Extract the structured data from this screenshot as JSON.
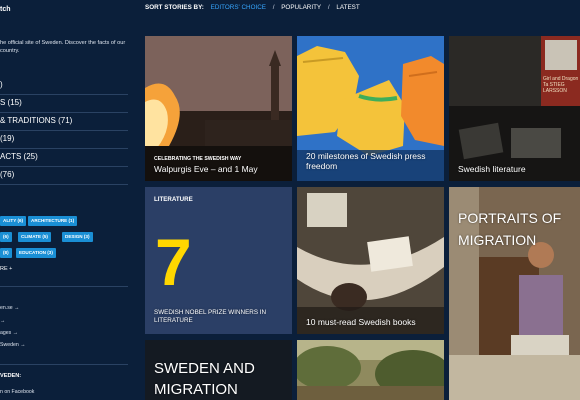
{
  "sidebar": {
    "title": "tch",
    "intro": "he official site of Sweden. Discover the facts of our country.",
    "categories": [
      {
        "label": ")"
      },
      {
        "label": "S (15)"
      },
      {
        "label": "& TRADITIONS (71)"
      },
      {
        "label": "(19)"
      },
      {
        "label": "ACTS (25)"
      },
      {
        "label": "(76)"
      }
    ],
    "tags": [
      "ALITY (6)",
      "ARCHITECTURE (1)",
      "(6)",
      "CLIMATE (5)",
      "DESIGN (3)",
      "(8)",
      "EDUCATION (3)"
    ],
    "more": "RE +",
    "links": [
      "en.se →",
      "→",
      "ages →",
      "Sweden →"
    ],
    "follow_title": "VEDEN:",
    "facebook": "n on Facebook"
  },
  "sort": {
    "label": "SORT STORIES BY:",
    "options": [
      "EDITORS' CHOICE",
      "POPULARITY",
      "LATEST"
    ],
    "separator": "/"
  },
  "tiles": [
    {
      "kicker": "CELEBRATING THE SWEDISH WAY",
      "caption": "Walpurgis Eve – and 1 May"
    },
    {
      "caption": "20 milestones of Swedish press freedom"
    },
    {
      "caption": "Swedish literature",
      "book_text": "Girl and Dragon Ta STIEG LARSSON"
    },
    {
      "kicker": "LITERATURE",
      "number": "7",
      "caption": "SWEDISH NOBEL PRIZE WINNERS IN LITERATURE"
    },
    {
      "caption": "10 must-read Swedish books"
    },
    {
      "caption": "PORTRAITS OF MIGRATION"
    },
    {
      "caption": "SWEDEN AND MIGRATION"
    },
    {
      "caption": ""
    }
  ],
  "colors": {
    "background": "#0b1f3a",
    "accent": "#37a7ff",
    "tag": "#1a8fd5",
    "highlight": "#ffd700"
  }
}
